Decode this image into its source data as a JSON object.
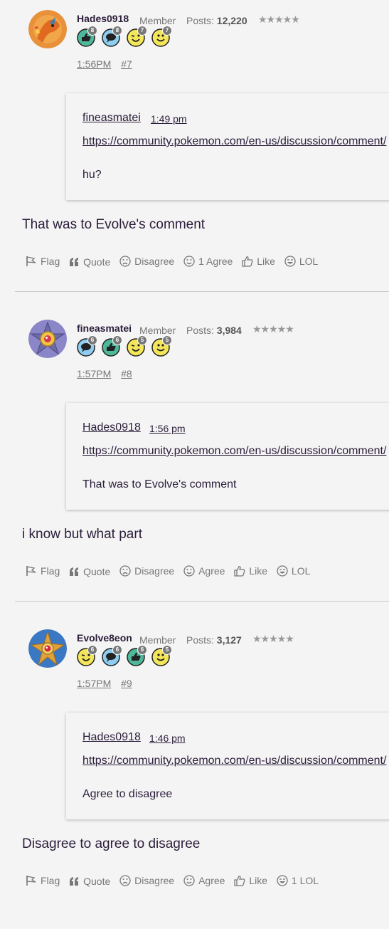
{
  "posts": [
    {
      "username": "Hades0918",
      "role": "Member",
      "posts_label": "Posts:",
      "post_count": "12,220",
      "stars": "★★★★★",
      "badges": [
        {
          "icon": "thumbs-up-badge-icon",
          "count": "8"
        },
        {
          "icon": "speech-bubble-badge-icon",
          "count": "8"
        },
        {
          "icon": "wink-face-badge-icon",
          "count": "7"
        },
        {
          "icon": "smile-face-badge-icon",
          "count": "7"
        }
      ],
      "time": "1:56PM",
      "permalink": "#7",
      "quote": {
        "author": "fineasmatei",
        "time": "1:49 pm",
        "link": "https://community.pokemon.com/en-us/discussion/comment/",
        "text": "hu?"
      },
      "body": "That was to Evolve's comment",
      "reactions": {
        "flag": "Flag",
        "quote": "Quote",
        "disagree": "Disagree",
        "agree": "1 Agree",
        "like": "Like",
        "lol": "LOL"
      }
    },
    {
      "username": "fineasmatei",
      "role": "Member",
      "posts_label": "Posts:",
      "post_count": "3,984",
      "stars": "★★★★★",
      "badges": [
        {
          "icon": "speech-bubble-badge-icon",
          "count": "6"
        },
        {
          "icon": "thumbs-up-badge-icon",
          "count": "6"
        },
        {
          "icon": "wink-face-badge-icon",
          "count": "5"
        },
        {
          "icon": "smile-face-badge-icon",
          "count": "5"
        }
      ],
      "time": "1:57PM",
      "permalink": "#8",
      "quote": {
        "author": "Hades0918",
        "time": "1:56 pm",
        "link": "https://community.pokemon.com/en-us/discussion/comment/",
        "text": "That was to Evolve's comment"
      },
      "body": "i know but what part",
      "reactions": {
        "flag": "Flag",
        "quote": "Quote",
        "disagree": "Disagree",
        "agree": "Agree",
        "like": "Like",
        "lol": "LOL"
      }
    },
    {
      "username": "Evolve8eon",
      "role": "Member",
      "posts_label": "Posts:",
      "post_count": "3,127",
      "stars": "★★★★★",
      "badges": [
        {
          "icon": "wink-face-badge-icon",
          "count": "6"
        },
        {
          "icon": "speech-bubble-badge-icon",
          "count": "6"
        },
        {
          "icon": "thumbs-up-badge-icon",
          "count": "6"
        },
        {
          "icon": "smile-face-badge-icon",
          "count": "5"
        }
      ],
      "time": "1:57PM",
      "permalink": "#9",
      "quote": {
        "author": "Hades0918",
        "time": "1:46 pm",
        "link": "https://community.pokemon.com/en-us/discussion/comment/",
        "text": "Agree to disagree"
      },
      "body": "Disagree to agree to disagree",
      "reactions": {
        "flag": "Flag",
        "quote": "Quote",
        "disagree": "Disagree",
        "agree": "Agree",
        "like": "Like",
        "lol": "1 LOL"
      }
    }
  ],
  "colors": {
    "text": "#2b1d3a",
    "muted": "#777777",
    "background": "#f4f4f4",
    "badge_teal": "#4fb89a",
    "badge_blue": "#8ecdf0",
    "badge_yellow": "#f4e65a"
  }
}
